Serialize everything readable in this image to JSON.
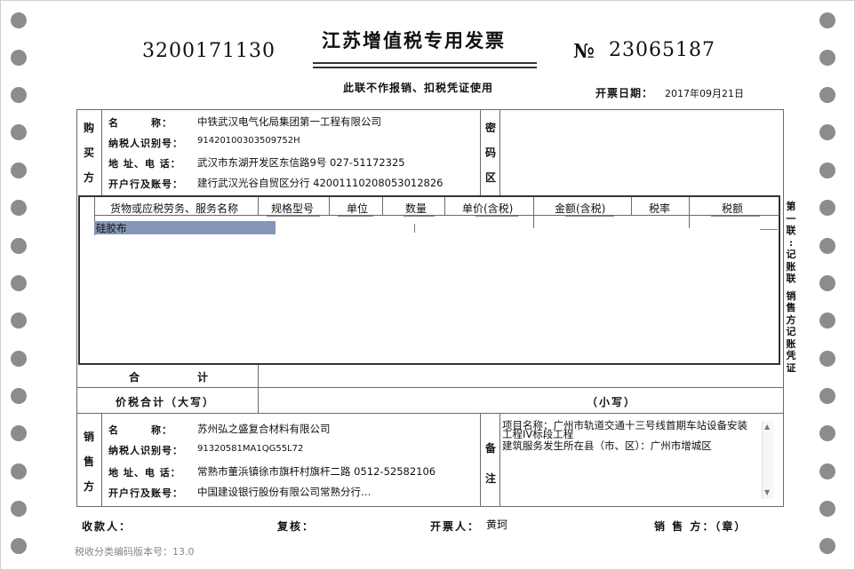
{
  "header": {
    "invoice_code": "3200171130",
    "title": "江苏增值税专用发票",
    "number_label": "№",
    "number": "23065187",
    "subtitle": "此联不作报销、扣税凭证使用",
    "date_label": "开票日期：",
    "date": "2017年09月21日"
  },
  "buyer": {
    "section_label": [
      "购",
      "买",
      "方"
    ],
    "name_label": "名　　　称：",
    "name": "中铁武汉电气化局集团第一工程有限公司",
    "tax_id_label": "纳税人识别号：",
    "tax_id": "91420100303509752H",
    "address_label": "地 址、电 话：",
    "address": "武汉市东湖开发区东信路9号 027-51172325",
    "bank_label": "开户行及账号：",
    "bank": "建行武汉光谷自贸区分行 42001110208053012826"
  },
  "password_area": {
    "label": [
      "密",
      "码",
      "区"
    ]
  },
  "items": {
    "headers": [
      "货物或应税劳务、服务名称",
      "规格型号",
      "单位",
      "数量",
      "单价(含税)",
      "金额(含税)",
      "税率",
      "税额"
    ],
    "rows": [
      {
        "name": "硅胶布"
      }
    ]
  },
  "totals": {
    "sum_label": "合",
    "sum_label2": "计",
    "total_label": "价税合计（大写）",
    "small_label": "（小写）"
  },
  "seller": {
    "section_label": [
      "销",
      "售",
      "方"
    ],
    "name_label": "名　　　称：",
    "name": "苏州弘之盛复合材料有限公司",
    "tax_id_label": "纳税人识别号：",
    "tax_id": "91320581MA1QG55L72",
    "address_label": "地 址、电 话：",
    "address": "常熟市董浜镇徐市旗杆村旗杆二路 0512-52582106",
    "bank_label": "开户行及账号：",
    "bank": "中国建设银行股份有限公司常熟分行…"
  },
  "remarks": {
    "label": [
      "备",
      "注"
    ],
    "lines": [
      "项目名称：广州市轨道交通十三号线首期车站设备安装",
      "工程IV标段工程",
      "建筑服务发生所在县（市、区）：广州市增城区"
    ]
  },
  "side_strip": [
    "第",
    "一",
    "联",
    ":",
    "记",
    "账",
    "联",
    "",
    "销",
    "售",
    "方",
    "记",
    "账",
    "凭",
    "证"
  ],
  "footer": {
    "payee_label": "收款人：",
    "reviewer_label": "复核：",
    "issuer_label": "开票人：",
    "issuer": "黄珂",
    "seller_seal_label": "销 售 方：（章）",
    "version": "税收分类编码版本号：13.0"
  }
}
